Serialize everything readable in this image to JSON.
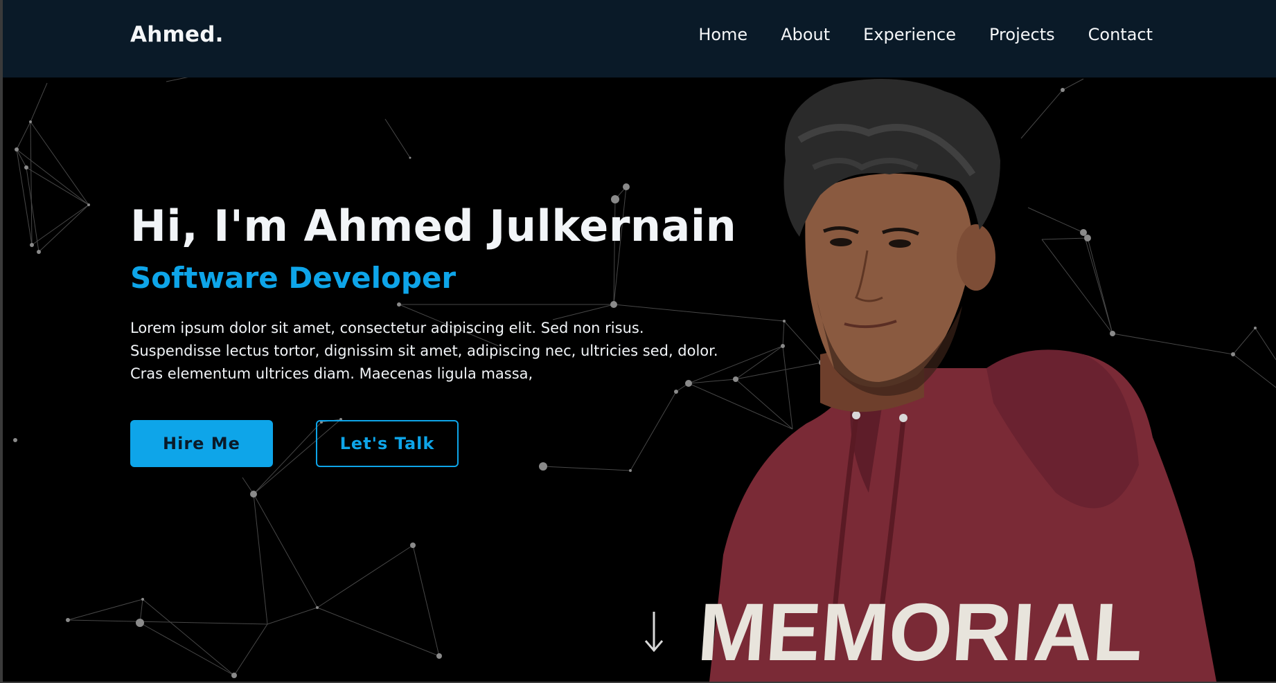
{
  "header": {
    "logo": "Ahmed.",
    "nav": [
      {
        "label": "Home"
      },
      {
        "label": "About"
      },
      {
        "label": "Experience"
      },
      {
        "label": "Projects"
      },
      {
        "label": "Contact"
      }
    ]
  },
  "hero": {
    "title": "Hi, I'm Ahmed Julkernain",
    "role": "Software Developer",
    "description_lines": [
      "Lorem ipsum dolor sit amet, consectetur adipiscing elit. Sed non risus.",
      "Suspendisse lectus tortor, dignissim sit amet, adipiscing nec, ultricies sed, dolor.",
      "Cras elementum ultrices diam. Maecenas ligula massa,"
    ],
    "hire_label": "Hire Me",
    "talk_label": "Let's Talk"
  },
  "portrait": {
    "hoodie_text": "MEMORIAL"
  },
  "icons": {
    "scroll": "arrow-down-icon"
  },
  "colors": {
    "nav_bg": "#0a1a28",
    "page_bg": "#000000",
    "accent": "#0ea5e9",
    "text": "#f2f5f8",
    "hoodie": "#7a2a36"
  }
}
